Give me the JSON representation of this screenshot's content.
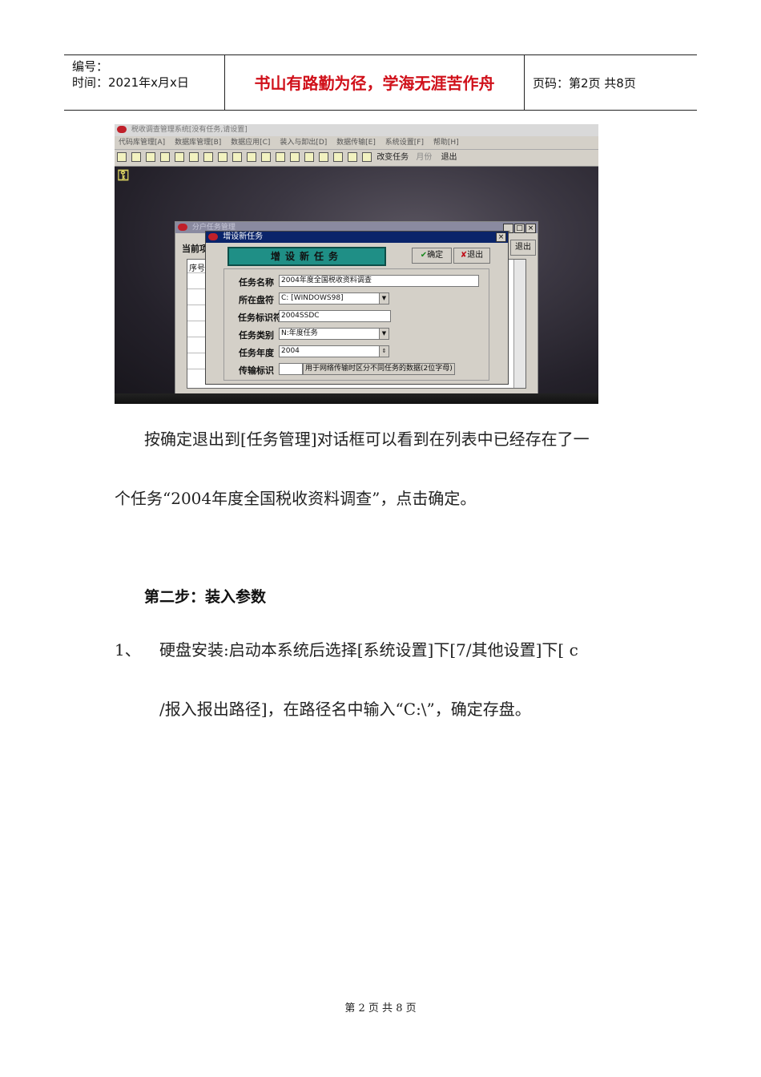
{
  "header": {
    "number_label": "编号：",
    "date": "时间：2021年x月x日",
    "motto": "书山有路勤为径，学海无涯苦作舟",
    "page": "页码：第2页  共8页"
  },
  "screenshot": {
    "app_title": "税收调查管理系统[没有任务,请设置]",
    "menu": [
      "代码库管理[A]",
      "数据库管理[B]",
      "数据应用[C]",
      "装入与卸出[D]",
      "数据传输[E]",
      "系统设置[F]",
      "帮助[H]"
    ],
    "toolbar": {
      "change_task": "改变任务",
      "month": "月份",
      "exit": "退出"
    },
    "manager_window": {
      "title": "分户任务管理",
      "current_label": "当前项",
      "exit": "退出",
      "col_seq": "序号"
    },
    "dialog": {
      "title": "增设新任务",
      "heading": "增设新任务",
      "ok": "确定",
      "exit": "退出",
      "fields": {
        "task_name": {
          "label": "任务名称",
          "value": "2004年度全国税收资料调查"
        },
        "drive": {
          "label": "所在盘符",
          "value": "C: [WINDOWS98]"
        },
        "task_id": {
          "label": "任务标识符",
          "value": "2004SSDC"
        },
        "task_type": {
          "label": "任务类别",
          "value": "N:年度任务"
        },
        "task_year": {
          "label": "任务年度",
          "value": "2004"
        },
        "transfer": {
          "label": "传输标识",
          "value": "",
          "hint": "用于网络传输时区分不同任务的数据(2位字母)"
        }
      }
    }
  },
  "body": {
    "p1_line1": "按确定退出到[任务管理]对话框可以看到在列表中已经存在了一",
    "p1_line2": "个任务“2004年度全国税收资料调查”，点击确定。",
    "step_title": "第二步：装入参数",
    "item_num": "1、",
    "item_line1": "硬盘安装:启动本系统后选择[系统设置]下[7/其他设置]下[ c",
    "item_line2": "/报入报出路径]，在路径名中输入“C:\\”，确定存盘。"
  },
  "footer": {
    "text": "第 2 页 共 8 页"
  }
}
